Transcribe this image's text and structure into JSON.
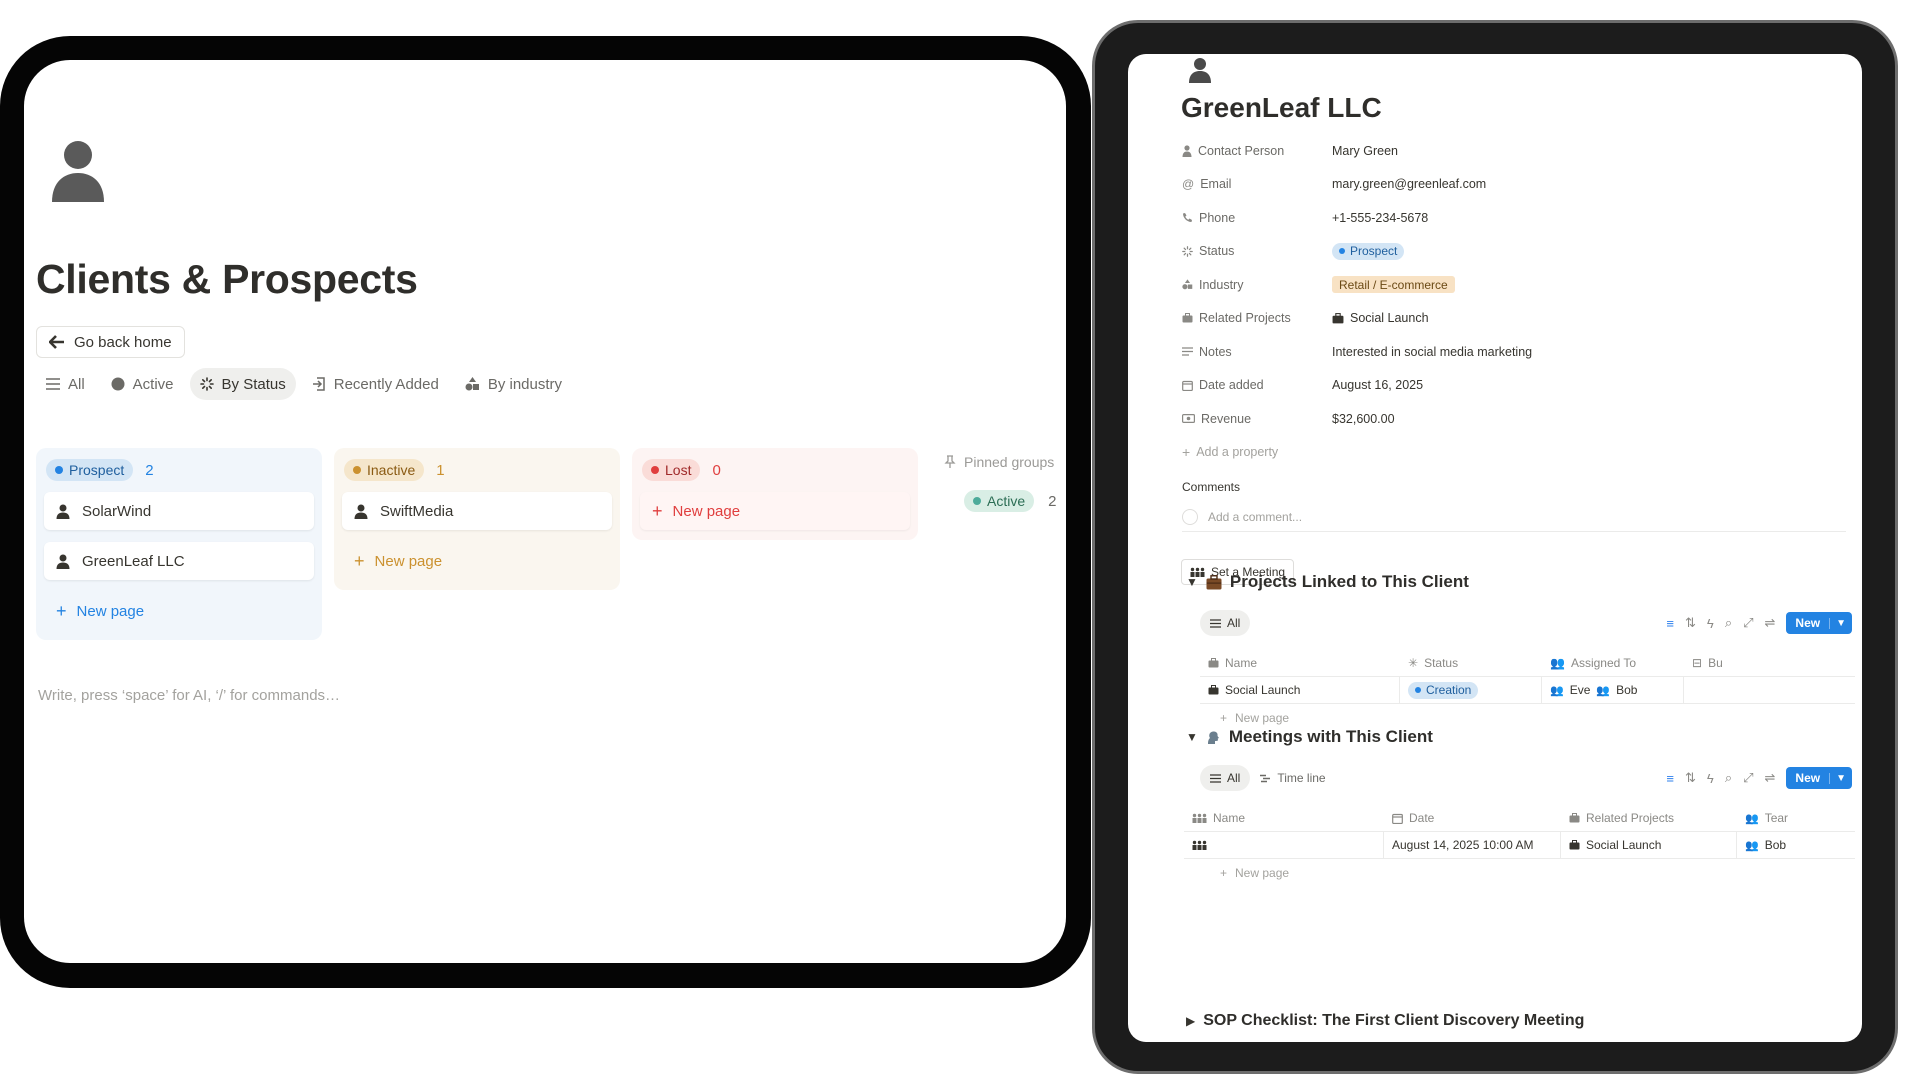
{
  "left": {
    "page_icon": "person-icon",
    "title": "Clients & Prospects",
    "go_home_label": "Go back home",
    "views": [
      {
        "label": "All",
        "icon": "list-icon"
      },
      {
        "label": "Active",
        "icon": "circle-icon"
      },
      {
        "label": "By Status",
        "icon": "status-icon"
      },
      {
        "label": "Recently Added",
        "icon": "enter-icon"
      },
      {
        "label": "By industry",
        "icon": "shapes-icon"
      }
    ],
    "active_view": "By Status",
    "columns": [
      {
        "name": "Prospect",
        "count": "2",
        "cards": [
          "SolarWind",
          "GreenLeaf LLC"
        ],
        "new_label": "New page",
        "color": "#2383e2"
      },
      {
        "name": "Inactive",
        "count": "1",
        "cards": [
          "SwiftMedia"
        ],
        "new_label": "New page",
        "color": "#cb912f"
      },
      {
        "name": "Lost",
        "count": "0",
        "cards": [],
        "new_label": "New page",
        "color": "#e03e3e"
      }
    ],
    "pinned_label": "Pinned groups",
    "pinned_group": {
      "name": "Active",
      "count": "2",
      "color": "#4dab9a"
    },
    "editor_hint": "Write, press ‘space’ for AI, ‘/’ for commands…"
  },
  "right": {
    "title": "GreenLeaf LLC",
    "properties": [
      {
        "key": "Contact Person",
        "icon": "person-icon",
        "value": "Mary Green"
      },
      {
        "key": "Email",
        "icon": "at-icon",
        "value": "mary.green@greenleaf.com"
      },
      {
        "key": "Phone",
        "icon": "phone-icon",
        "value": "+1-555-234-5678"
      },
      {
        "key": "Status",
        "icon": "status-icon",
        "value": "Prospect"
      },
      {
        "key": "Industry",
        "icon": "shapes-icon",
        "value": "Retail / E-commerce"
      },
      {
        "key": "Related Projects",
        "icon": "briefcase-icon",
        "value": "Social Launch"
      },
      {
        "key": "Notes",
        "icon": "text-icon",
        "value": "Interested in social media marketing"
      },
      {
        "key": "Date added",
        "icon": "calendar-icon",
        "value": "August 16, 2025"
      },
      {
        "key": "Revenue",
        "icon": "money-icon",
        "value": "$32,600.00"
      }
    ],
    "add_property": "Add a property",
    "comments_heading": "Comments",
    "comment_placeholder": "Add a comment...",
    "meeting_button": "Set a Meeting",
    "projects": {
      "heading": "Projects Linked to This Client",
      "tab": "All",
      "new_label": "New",
      "columns": [
        "Name",
        "Status",
        "Assigned To",
        "Bu"
      ],
      "rows": [
        {
          "name": "Social Launch",
          "status": "Creation",
          "assigned": [
            "Eve",
            "Bob"
          ]
        }
      ],
      "new_page": "New page"
    },
    "meetings": {
      "heading": "Meetings with This Client",
      "tabs": [
        "All",
        "Time line"
      ],
      "new_label": "New",
      "columns": [
        "Name",
        "Date",
        "Related Projects",
        "Tear"
      ],
      "rows": [
        {
          "name": "",
          "date": "August 14, 2025 10:00 AM",
          "project": "Social Launch",
          "team": "Bob"
        }
      ],
      "new_page": "New page"
    },
    "sop_heading": "SOP Checklist: The First Client Discovery Meeting"
  },
  "colors": {
    "blue": "#2383e2",
    "orange": "#cb912f",
    "red": "#e03e3e",
    "green": "#4dab9a"
  }
}
